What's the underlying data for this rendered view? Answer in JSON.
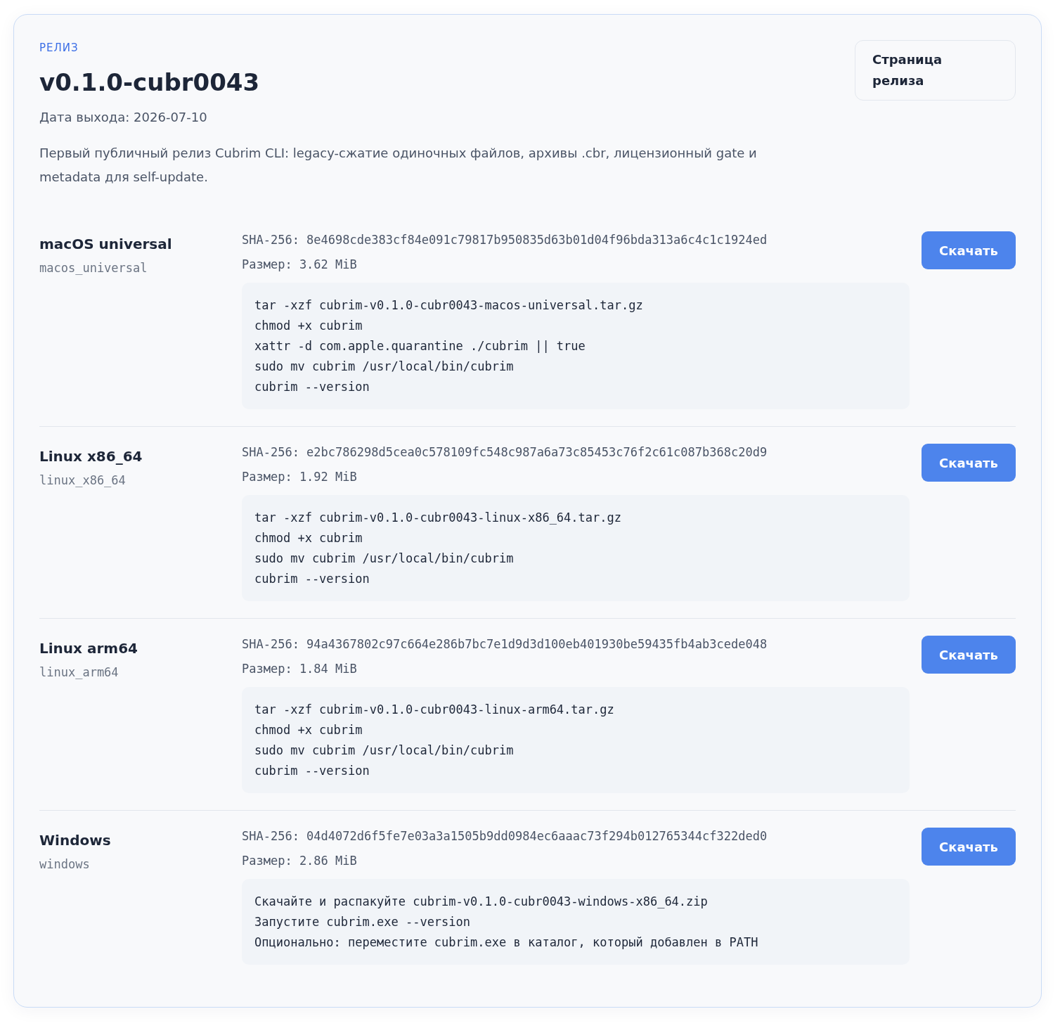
{
  "release": {
    "eyebrow": "РЕЛИЗ",
    "title": "v0.1.0-cubr0043",
    "date": "Дата выхода: 2026-07-10",
    "description": "Первый публичный релиз Cubrim CLI: legacy-сжатие одиночных файлов, архивы .cbr, лицензионный gate и metadata для self-update.",
    "page_button": "Страница релиза"
  },
  "assets": [
    {
      "name": "macOS universal",
      "slug": "macos_universal",
      "sha": "SHA-256: 8e4698cde383cf84e091c79817b950835d63b01d04f96bda313a6c4c1c1924ed",
      "size": "Размер: 3.62 MiB",
      "commands": [
        "tar -xzf cubrim-v0.1.0-cubr0043-macos-universal.tar.gz",
        "chmod +x cubrim",
        "xattr -d com.apple.quarantine ./cubrim || true",
        "sudo mv cubrim /usr/local/bin/cubrim",
        "cubrim --version"
      ],
      "button": "Скачать"
    },
    {
      "name": "Linux x86_64",
      "slug": "linux_x86_64",
      "sha": "SHA-256: e2bc786298d5cea0c578109fc548c987a6a73c85453c76f2c61c087b368c20d9",
      "size": "Размер: 1.92 MiB",
      "commands": [
        "tar -xzf cubrim-v0.1.0-cubr0043-linux-x86_64.tar.gz",
        "chmod +x cubrim",
        "sudo mv cubrim /usr/local/bin/cubrim",
        "cubrim --version"
      ],
      "button": "Скачать"
    },
    {
      "name": "Linux arm64",
      "slug": "linux_arm64",
      "sha": "SHA-256: 94a4367802c97c664e286b7bc7e1d9d3d100eb401930be59435fb4ab3cede048",
      "size": "Размер: 1.84 MiB",
      "commands": [
        "tar -xzf cubrim-v0.1.0-cubr0043-linux-arm64.tar.gz",
        "chmod +x cubrim",
        "sudo mv cubrim /usr/local/bin/cubrim",
        "cubrim --version"
      ],
      "button": "Скачать"
    },
    {
      "name": "Windows",
      "slug": "windows",
      "sha": "SHA-256: 04d4072d6f5fe7e03a3a1505b9dd0984ec6aaac73f294b012765344cf322ded0",
      "size": "Размер: 2.86 MiB",
      "commands": [
        "Скачайте и распакуйте cubrim-v0.1.0-cubr0043-windows-x86_64.zip",
        "Запустите cubrim.exe --version",
        "Опционально: переместите cubrim.exe в каталог, который добавлен в PATH"
      ],
      "button": "Скачать"
    }
  ]
}
